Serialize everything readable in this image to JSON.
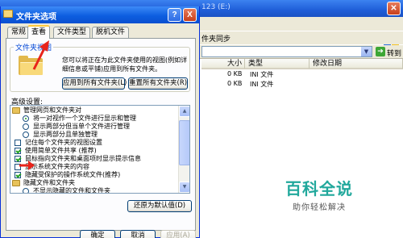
{
  "explorer": {
    "title": "123 (E:)",
    "toolbar_text": "件夹同步",
    "go_label": "转到",
    "columns": [
      "大小",
      "类型",
      "修改日期"
    ],
    "rows": [
      {
        "size": "0 KB",
        "type": "INI 文件"
      },
      {
        "size": "0 KB",
        "type": "INI 文件"
      }
    ]
  },
  "watermark": {
    "title": "百科全说",
    "subtitle": "助你轻松解决"
  },
  "dialog": {
    "title": "文件夹选项",
    "help_button": "?",
    "close_button": "X",
    "tabs": [
      "常规",
      "查看",
      "文件类型",
      "脱机文件"
    ],
    "active_tab": 1,
    "folder_views": {
      "group_label": "文件夹视图",
      "description": "您可以将正在为此文件夹使用的视图(例如详细信息或平铺)应用到所有文件夹。",
      "apply_all_button": "应用到所有文件夹(L)",
      "reset_all_button": "重置所有文件夹(R)"
    },
    "advanced_label": "高级设置:",
    "advanced_items": [
      {
        "kind": "folder",
        "label": "管理网页和文件夹对"
      },
      {
        "kind": "radio",
        "checked": true,
        "label": "将一对视作一个文件进行显示和管理"
      },
      {
        "kind": "radio",
        "checked": false,
        "label": "显示两部分但当单个文件进行管理"
      },
      {
        "kind": "radio",
        "checked": false,
        "label": "显示两部分且单独管理"
      },
      {
        "kind": "checkbox",
        "checked": false,
        "label": "记住每个文件夹的视图设置"
      },
      {
        "kind": "checkbox",
        "checked": true,
        "label": "使用简单文件共享 (推荐)"
      },
      {
        "kind": "checkbox",
        "checked": true,
        "label": "鼠标指向文件夹和桌面项时显示提示信息"
      },
      {
        "kind": "checkbox",
        "checked": false,
        "label": "显示系统文件夹的内容"
      },
      {
        "kind": "checkbox",
        "checked": true,
        "label": "隐藏受保护的操作系统文件(推荐)"
      },
      {
        "kind": "folder",
        "label": "隐藏文件和文件夹"
      },
      {
        "kind": "radio",
        "checked": false,
        "label": "不显示隐藏的文件和文件夹"
      }
    ],
    "restore_defaults_button": "还原为默认值(D)",
    "ok_button": "确定",
    "cancel_button": "取消",
    "apply_button": "应用(A)"
  }
}
